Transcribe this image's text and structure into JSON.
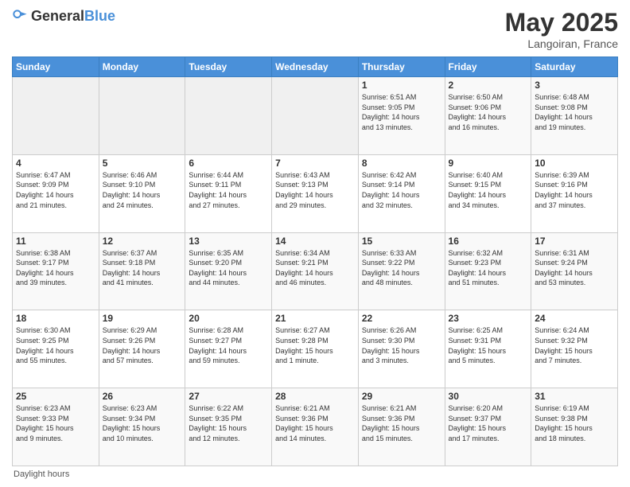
{
  "header": {
    "logo_general": "General",
    "logo_blue": "Blue",
    "month_title": "May 2025",
    "location": "Langoiran, France"
  },
  "weekdays": [
    "Sunday",
    "Monday",
    "Tuesday",
    "Wednesday",
    "Thursday",
    "Friday",
    "Saturday"
  ],
  "footer": {
    "note": "Daylight hours"
  },
  "weeks": [
    [
      {
        "day": "",
        "info": ""
      },
      {
        "day": "",
        "info": ""
      },
      {
        "day": "",
        "info": ""
      },
      {
        "day": "",
        "info": ""
      },
      {
        "day": "1",
        "info": "Sunrise: 6:51 AM\nSunset: 9:05 PM\nDaylight: 14 hours\nand 13 minutes."
      },
      {
        "day": "2",
        "info": "Sunrise: 6:50 AM\nSunset: 9:06 PM\nDaylight: 14 hours\nand 16 minutes."
      },
      {
        "day": "3",
        "info": "Sunrise: 6:48 AM\nSunset: 9:08 PM\nDaylight: 14 hours\nand 19 minutes."
      }
    ],
    [
      {
        "day": "4",
        "info": "Sunrise: 6:47 AM\nSunset: 9:09 PM\nDaylight: 14 hours\nand 21 minutes."
      },
      {
        "day": "5",
        "info": "Sunrise: 6:46 AM\nSunset: 9:10 PM\nDaylight: 14 hours\nand 24 minutes."
      },
      {
        "day": "6",
        "info": "Sunrise: 6:44 AM\nSunset: 9:11 PM\nDaylight: 14 hours\nand 27 minutes."
      },
      {
        "day": "7",
        "info": "Sunrise: 6:43 AM\nSunset: 9:13 PM\nDaylight: 14 hours\nand 29 minutes."
      },
      {
        "day": "8",
        "info": "Sunrise: 6:42 AM\nSunset: 9:14 PM\nDaylight: 14 hours\nand 32 minutes."
      },
      {
        "day": "9",
        "info": "Sunrise: 6:40 AM\nSunset: 9:15 PM\nDaylight: 14 hours\nand 34 minutes."
      },
      {
        "day": "10",
        "info": "Sunrise: 6:39 AM\nSunset: 9:16 PM\nDaylight: 14 hours\nand 37 minutes."
      }
    ],
    [
      {
        "day": "11",
        "info": "Sunrise: 6:38 AM\nSunset: 9:17 PM\nDaylight: 14 hours\nand 39 minutes."
      },
      {
        "day": "12",
        "info": "Sunrise: 6:37 AM\nSunset: 9:18 PM\nDaylight: 14 hours\nand 41 minutes."
      },
      {
        "day": "13",
        "info": "Sunrise: 6:35 AM\nSunset: 9:20 PM\nDaylight: 14 hours\nand 44 minutes."
      },
      {
        "day": "14",
        "info": "Sunrise: 6:34 AM\nSunset: 9:21 PM\nDaylight: 14 hours\nand 46 minutes."
      },
      {
        "day": "15",
        "info": "Sunrise: 6:33 AM\nSunset: 9:22 PM\nDaylight: 14 hours\nand 48 minutes."
      },
      {
        "day": "16",
        "info": "Sunrise: 6:32 AM\nSunset: 9:23 PM\nDaylight: 14 hours\nand 51 minutes."
      },
      {
        "day": "17",
        "info": "Sunrise: 6:31 AM\nSunset: 9:24 PM\nDaylight: 14 hours\nand 53 minutes."
      }
    ],
    [
      {
        "day": "18",
        "info": "Sunrise: 6:30 AM\nSunset: 9:25 PM\nDaylight: 14 hours\nand 55 minutes."
      },
      {
        "day": "19",
        "info": "Sunrise: 6:29 AM\nSunset: 9:26 PM\nDaylight: 14 hours\nand 57 minutes."
      },
      {
        "day": "20",
        "info": "Sunrise: 6:28 AM\nSunset: 9:27 PM\nDaylight: 14 hours\nand 59 minutes."
      },
      {
        "day": "21",
        "info": "Sunrise: 6:27 AM\nSunset: 9:28 PM\nDaylight: 15 hours\nand 1 minute."
      },
      {
        "day": "22",
        "info": "Sunrise: 6:26 AM\nSunset: 9:30 PM\nDaylight: 15 hours\nand 3 minutes."
      },
      {
        "day": "23",
        "info": "Sunrise: 6:25 AM\nSunset: 9:31 PM\nDaylight: 15 hours\nand 5 minutes."
      },
      {
        "day": "24",
        "info": "Sunrise: 6:24 AM\nSunset: 9:32 PM\nDaylight: 15 hours\nand 7 minutes."
      }
    ],
    [
      {
        "day": "25",
        "info": "Sunrise: 6:23 AM\nSunset: 9:33 PM\nDaylight: 15 hours\nand 9 minutes."
      },
      {
        "day": "26",
        "info": "Sunrise: 6:23 AM\nSunset: 9:34 PM\nDaylight: 15 hours\nand 10 minutes."
      },
      {
        "day": "27",
        "info": "Sunrise: 6:22 AM\nSunset: 9:35 PM\nDaylight: 15 hours\nand 12 minutes."
      },
      {
        "day": "28",
        "info": "Sunrise: 6:21 AM\nSunset: 9:36 PM\nDaylight: 15 hours\nand 14 minutes."
      },
      {
        "day": "29",
        "info": "Sunrise: 6:21 AM\nSunset: 9:36 PM\nDaylight: 15 hours\nand 15 minutes."
      },
      {
        "day": "30",
        "info": "Sunrise: 6:20 AM\nSunset: 9:37 PM\nDaylight: 15 hours\nand 17 minutes."
      },
      {
        "day": "31",
        "info": "Sunrise: 6:19 AM\nSunset: 9:38 PM\nDaylight: 15 hours\nand 18 minutes."
      }
    ]
  ]
}
